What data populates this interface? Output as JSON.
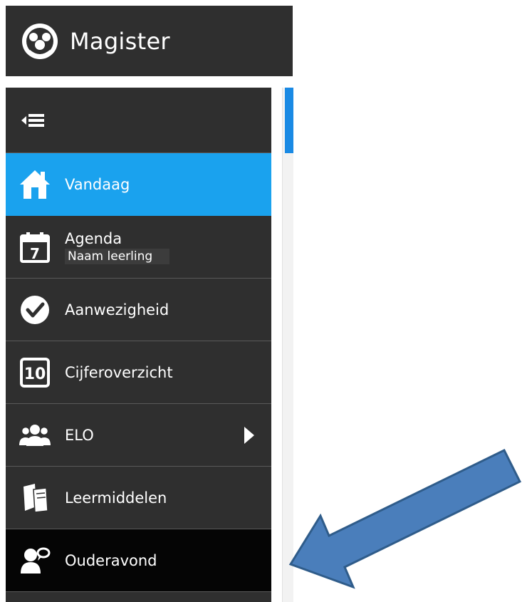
{
  "header": {
    "app_title": "Magister"
  },
  "sidebar": {
    "items": [
      {
        "label": "Vandaag"
      },
      {
        "label": "Agenda",
        "sub_label": "Naam leerling",
        "calendar_day": "7"
      },
      {
        "label": "Aanwezigheid"
      },
      {
        "label": "Cijferoverzicht",
        "grade_badge": "10"
      },
      {
        "label": "ELO"
      },
      {
        "label": "Leermiddelen"
      },
      {
        "label": "Ouderavond"
      }
    ]
  },
  "colors": {
    "sidebar_bg": "#2f2f2f",
    "active_bg": "#1aa2ee",
    "arrow_fill": "#4a7ebb",
    "arrow_stroke": "#2f5c8a"
  }
}
